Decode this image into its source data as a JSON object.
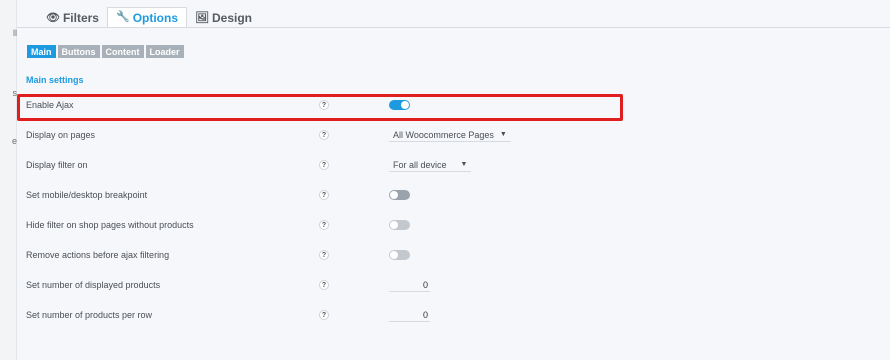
{
  "left_rail": {
    "fragments": [
      "ll",
      "s",
      "e"
    ]
  },
  "tabs": [
    {
      "label": "Filters",
      "icon": "eye-icon",
      "glyph": "👁"
    },
    {
      "label": "Options",
      "icon": "wrench-icon",
      "glyph": "🔧"
    },
    {
      "label": "Design",
      "icon": "image-icon",
      "glyph": "🖼"
    }
  ],
  "subtabs": [
    "Main",
    "Buttons",
    "Content",
    "Loader"
  ],
  "section_title": "Main settings",
  "help_glyph": "?",
  "settings": [
    {
      "label": "Enable Ajax",
      "control": "toggle",
      "state": true
    },
    {
      "label": "Display on pages",
      "control": "select",
      "value": "All Woocommerce Pages"
    },
    {
      "label": "Display filter on",
      "control": "select",
      "value": "For all device"
    },
    {
      "label": "Set mobile/desktop breakpoint",
      "control": "toggle",
      "state": false
    },
    {
      "label": "Hide filter on shop pages without products",
      "control": "toggle",
      "state": false
    },
    {
      "label": "Remove actions before ajax filtering",
      "control": "toggle",
      "state": false
    },
    {
      "label": "Set number of displayed products",
      "control": "number",
      "value": "0"
    },
    {
      "label": "Set number of products per row",
      "control": "number",
      "value": "0"
    }
  ],
  "colors": {
    "accent": "#1e9be0",
    "highlight": "#e01e1e",
    "inactive_tab": "#a8b1ba"
  }
}
